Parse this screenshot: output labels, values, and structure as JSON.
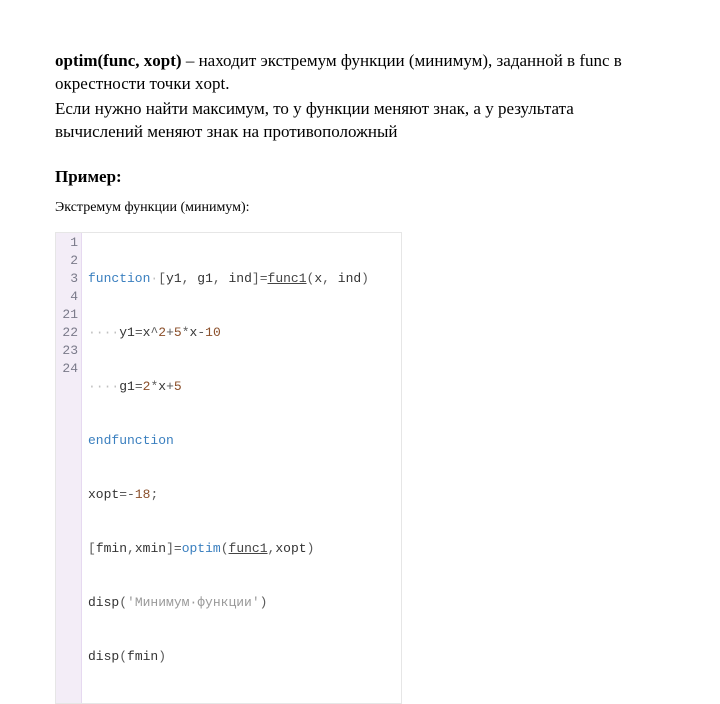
{
  "header": {
    "func_signature": "optim(func, xopt)",
    "desc_part1": " – находит экстремум функции (минимум), заданной в func в окрестности точки xopt.",
    "desc_part2": "Если нужно найти максимум, то у функции меняют знак, а у результата вычислений меняют знак на противоположный"
  },
  "example": {
    "label": "Пример:",
    "caption": "Экстремум функции (минимум):"
  },
  "code": {
    "line_numbers": [
      "1",
      "2",
      "3",
      "4",
      "21",
      "22",
      "23",
      "24"
    ],
    "l1": {
      "kw_function": "function",
      "sp": " ",
      "br_open": "[",
      "y1": "y1",
      "comma1": ", ",
      "g1": "g1",
      "comma2": ", ",
      "ind": "ind",
      "br_close": "]",
      "eq": "=",
      "fname": "func1",
      "paren_open": "(",
      "x": "x",
      "comma3": ", ",
      "ind2": "ind",
      "paren_close": ")"
    },
    "l2": {
      "indent": "····",
      "y1": "y1",
      "eq": "=",
      "x": "x",
      "pow": "^",
      "n2": "2",
      "plus": "+",
      "n5": "5",
      "star": "*",
      "x2": "x",
      "minus": "-",
      "n10": "10"
    },
    "l3": {
      "indent": "····",
      "g1": "g1",
      "eq": "=",
      "n2": "2",
      "star": "*",
      "x": "x",
      "plus": "+",
      "n5": "5"
    },
    "l4": {
      "kw_end": "endfunction"
    },
    "l5": {
      "xopt": "xopt",
      "eq": "=",
      "minus": "-",
      "n18": "18",
      "semi": ";"
    },
    "l6": {
      "br_open": "[",
      "fmin": "fmin",
      "comma": ",",
      "xmin": "xmin",
      "br_close": "]",
      "eq": "=",
      "optim": "optim",
      "paren_open": "(",
      "fname": "func1",
      "comma2": ",",
      "xopt": "xopt",
      "paren_close": ")"
    },
    "l7": {
      "disp": "disp",
      "paren_open": "(",
      "str": "'Минимум·функции'",
      "paren_close": ")"
    },
    "l8": {
      "disp": "disp",
      "paren_open": "(",
      "fmin": "fmin",
      "paren_close": ")"
    }
  }
}
